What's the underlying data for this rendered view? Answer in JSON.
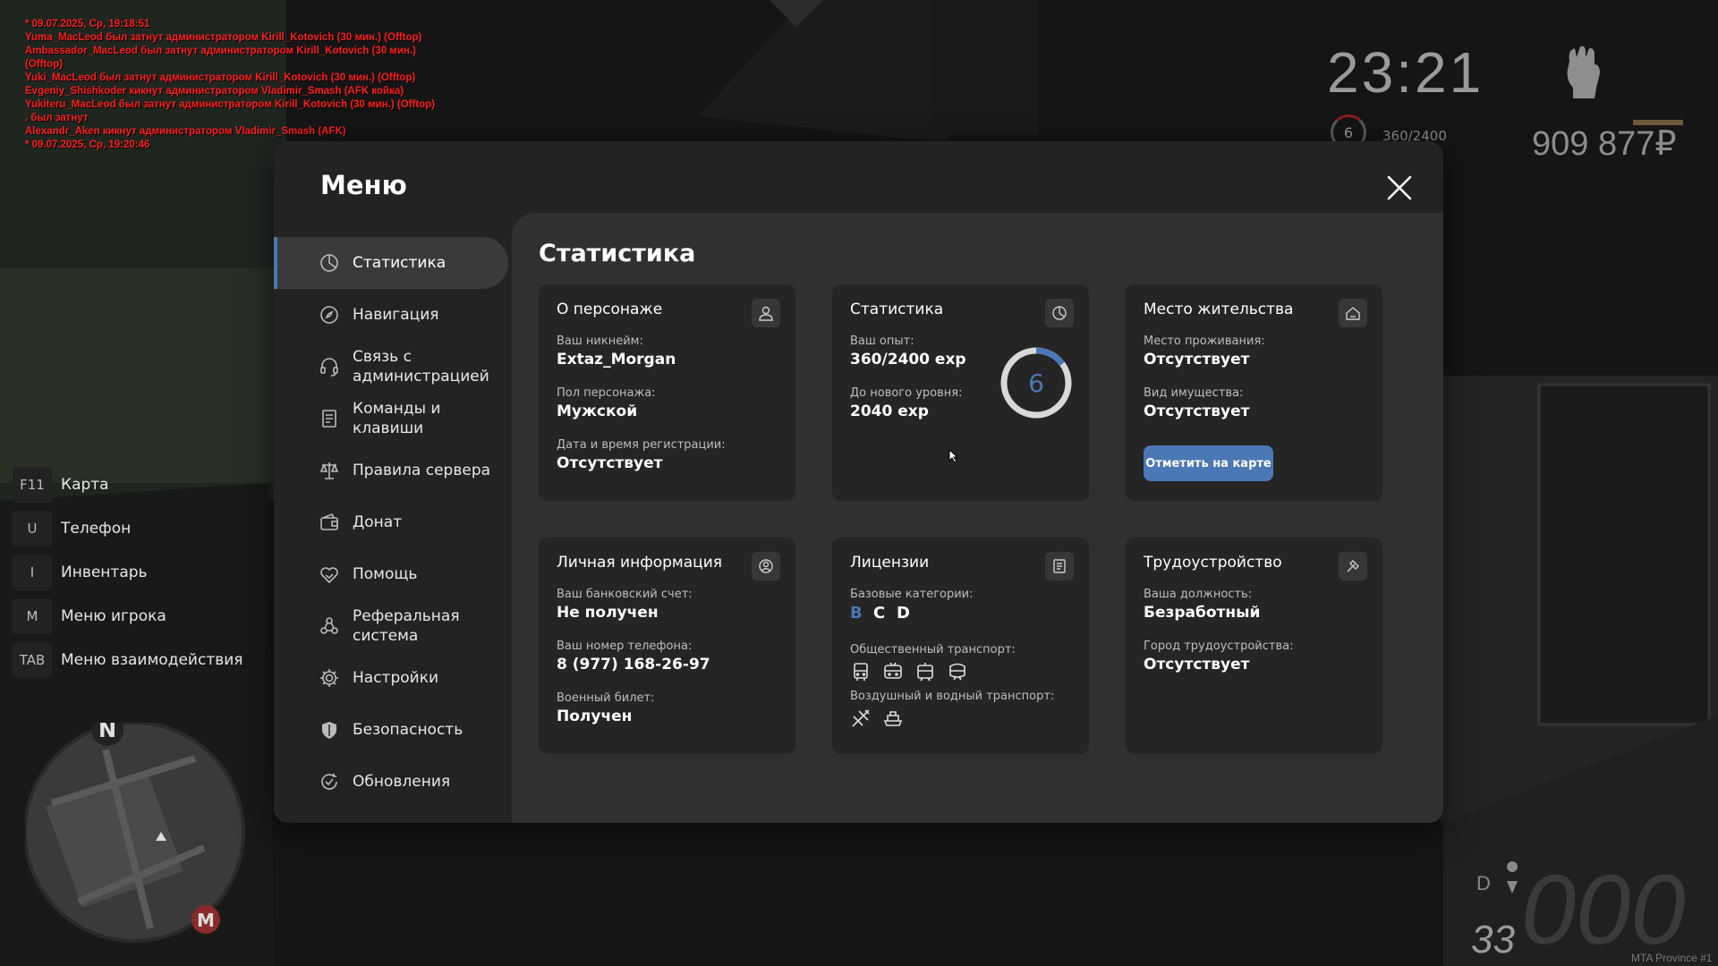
{
  "chat": [
    "* 09.07.2025, Ср, 19:18:51",
    "Yuma_MacLeod был затнут администратором Kirill_Kotovich (30 мин.) (Offtop)",
    "Ambassador_MacLeod был затнут администратором Kirill_Kotovich (30 мин.)",
    "(Offtop)",
    "Yuki_MacLeod был затнут администратором Kirill_Kotovich (30 мин.) (Offtop)",
    "Evgeniy_Shishkoder кикнут администратором Vladimir_Smash (AFK койка)",
    "Yukiteru_MacLeod был затнут администратором Kirill_Kotovich (30 мин.) (Offtop)",
    ". был затнут",
    "Alexandr_Aken кикнут администратором Vladimir_Smash (AFK)",
    "* 09.07.2025, Ср, 19:20:46"
  ],
  "hud": {
    "time": "23:21",
    "level": "6",
    "exp": "360/2400",
    "money": "909 877₽"
  },
  "hotkeys": [
    {
      "key": "F11",
      "label": "Карта"
    },
    {
      "key": "U",
      "label": "Телефон"
    },
    {
      "key": "I",
      "label": "Инвентарь"
    },
    {
      "key": "M",
      "label": "Меню игрока"
    },
    {
      "key": "TAB",
      "label": "Меню взаимодействия"
    }
  ],
  "minimap": {
    "north": "N",
    "metro": "M"
  },
  "speedometer": {
    "speed": "000",
    "fuel": "33",
    "gear": "D"
  },
  "watermark": "MTA Province #1",
  "menu": {
    "title": "Меню",
    "nav": [
      {
        "label": "Статистика",
        "icon": "pie-chart-icon"
      },
      {
        "label": "Навигация",
        "icon": "compass-icon"
      },
      {
        "label": "Связь с администрацией",
        "icon": "headset-icon"
      },
      {
        "label": "Команды и клавиши",
        "icon": "document-list-icon"
      },
      {
        "label": "Правила сервера",
        "icon": "scales-icon"
      },
      {
        "label": "Донат",
        "icon": "wallet-icon"
      },
      {
        "label": "Помощь",
        "icon": "handshake-heart-icon"
      },
      {
        "label": "Реферальная система",
        "icon": "people-network-icon"
      },
      {
        "label": "Настройки",
        "icon": "gear-icon"
      },
      {
        "label": "Безопасность",
        "icon": "shield-icon"
      },
      {
        "label": "Обновления",
        "icon": "refresh-check-icon"
      }
    ],
    "active": "Статистика"
  },
  "content": {
    "title": "Статистика",
    "character": {
      "title": "О персонаже",
      "nick_label": "Ваш никнейм:",
      "nick": "Extaz_Morgan",
      "sex_label": "Пол персонажа:",
      "sex": "Мужской",
      "reg_label": "Дата и время регистрации:",
      "reg": "Отсутствует"
    },
    "stats": {
      "title": "Статистика",
      "exp_label": "Ваш опыт:",
      "exp": "360/2400 exp",
      "next_label": "До нового уровня:",
      "next": "2040 exp",
      "level": "6",
      "progress": 0.15
    },
    "residence": {
      "title": "Место жительства",
      "place_label": "Место проживания:",
      "place": "Отсутствует",
      "prop_label": "Вид имущества:",
      "prop": "Отсутствует",
      "button": "Отметить на карте"
    },
    "personal": {
      "title": "Личная информация",
      "bank_label": "Ваш банковский счет:",
      "bank": "Не получен",
      "phone_label": "Ваш номер телефона:",
      "phone": "8 (977) 168-26-97",
      "military_label": "Военный билет:",
      "military": "Получен"
    },
    "licenses": {
      "title": "Лицензии",
      "basic_label": "Базовые категории:",
      "cat_b": "B",
      "cat_c": "C",
      "cat_d": "D",
      "public_label": "Общественный транспорт:",
      "air_label": "Воздушный и водный транспорт:"
    },
    "employment": {
      "title": "Трудоустройство",
      "job_label": "Ваша должность:",
      "job": "Безработный",
      "city_label": "Город трудоустройства:",
      "city": "Отсутствует"
    }
  },
  "colors": {
    "accent": "#4b78b4",
    "chat": "#ff1e1e",
    "modal_bg": "#232323",
    "content_bg": "#303030",
    "card_bg": "#252525"
  }
}
